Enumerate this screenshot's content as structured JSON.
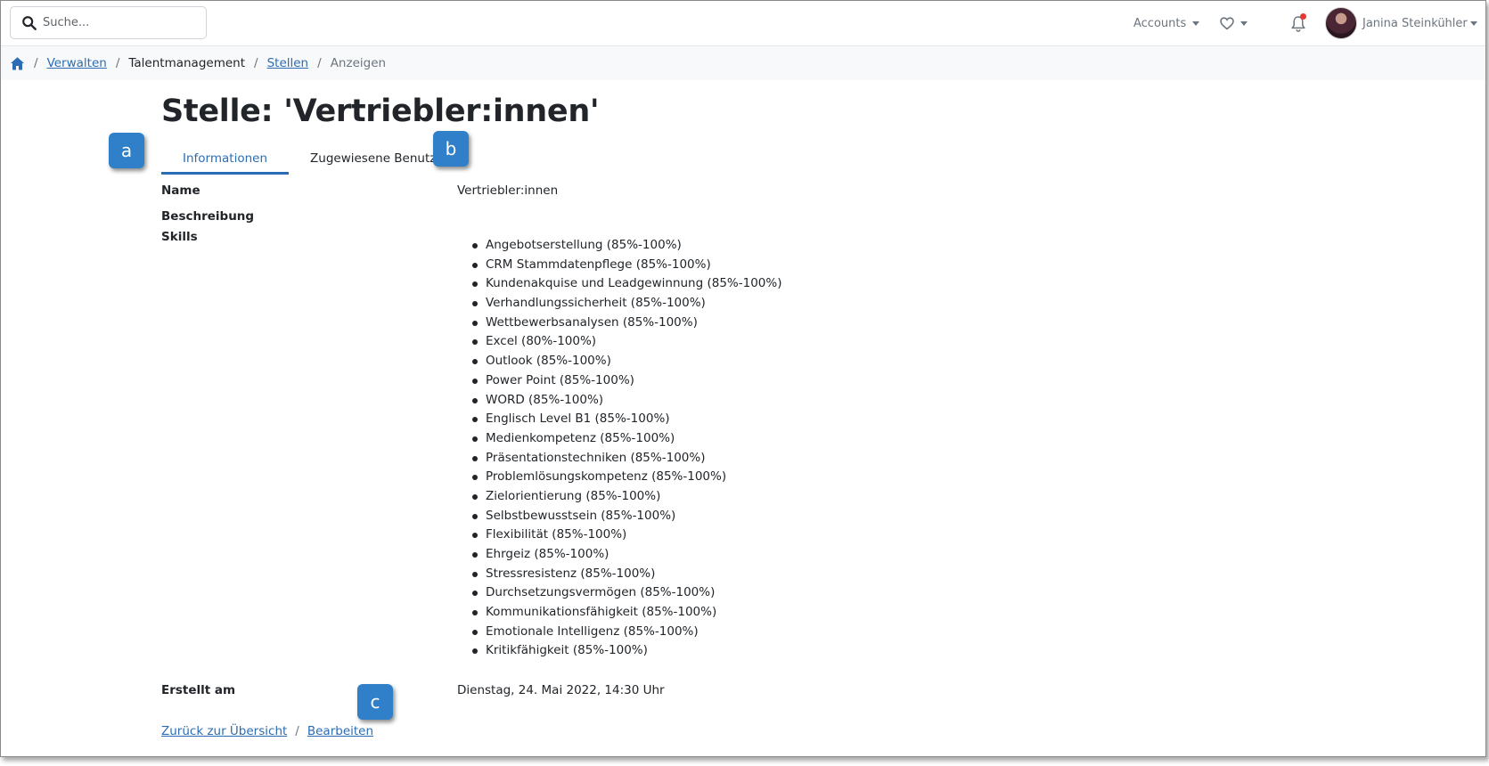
{
  "search": {
    "placeholder": "Suche..."
  },
  "header": {
    "accounts_label": "Accounts",
    "user_name": "Janina Steinkühler",
    "notification_dot_color": "#e53935"
  },
  "breadcrumb": {
    "home_icon": "home-icon",
    "items": [
      {
        "label": "Verwalten",
        "link": true
      },
      {
        "label": "Talentmanagement",
        "link": false
      },
      {
        "label": "Stellen",
        "link": true
      },
      {
        "label": "Anzeigen",
        "link": false
      }
    ]
  },
  "page": {
    "title": "Stelle: 'Vertriebler:innen'"
  },
  "tabs": [
    {
      "label": "Informationen",
      "active": true
    },
    {
      "label": "Zugewiesene Benutzer",
      "active": false
    }
  ],
  "markers": {
    "a": "a",
    "b": "b",
    "c": "c",
    "color": "#2f80c9"
  },
  "details": {
    "name_label": "Name",
    "name_value": "Vertriebler:innen",
    "description_label": "Beschreibung",
    "skills_label": "Skills",
    "skills": [
      "Angebotserstellung (85%-100%)",
      "CRM Stammdatenpflege (85%-100%)",
      "Kundenakquise und Leadgewinnung (85%-100%)",
      "Verhandlungssicherheit (85%-100%)",
      "Wettbewerbsanalysen (85%-100%)",
      "Excel (80%-100%)",
      "Outlook (85%-100%)",
      "Power Point (85%-100%)",
      "WORD (85%-100%)",
      "Englisch Level B1 (85%-100%)",
      "Medienkompetenz (85%-100%)",
      "Präsentationstechniken (85%-100%)",
      "Problemlösungskompetenz (85%-100%)",
      "Zielorientierung (85%-100%)",
      "Selbstbewusstsein (85%-100%)",
      "Flexibilität (85%-100%)",
      "Ehrgeiz (85%-100%)",
      "Stressresistenz (85%-100%)",
      "Durchsetzungsvermögen (85%-100%)",
      "Kommunikationsfähigkeit (85%-100%)",
      "Emotionale Intelligenz (85%-100%)",
      "Kritikfähigkeit (85%-100%)"
    ],
    "created_label": "Erstellt am",
    "created_value": "Dienstag, 24. Mai 2022, 14:30 Uhr"
  },
  "footer": {
    "back_label": "Zurück zur Übersicht",
    "separator": "/",
    "edit_label": "Bearbeiten"
  },
  "colors": {
    "accent": "#2a6db5"
  }
}
